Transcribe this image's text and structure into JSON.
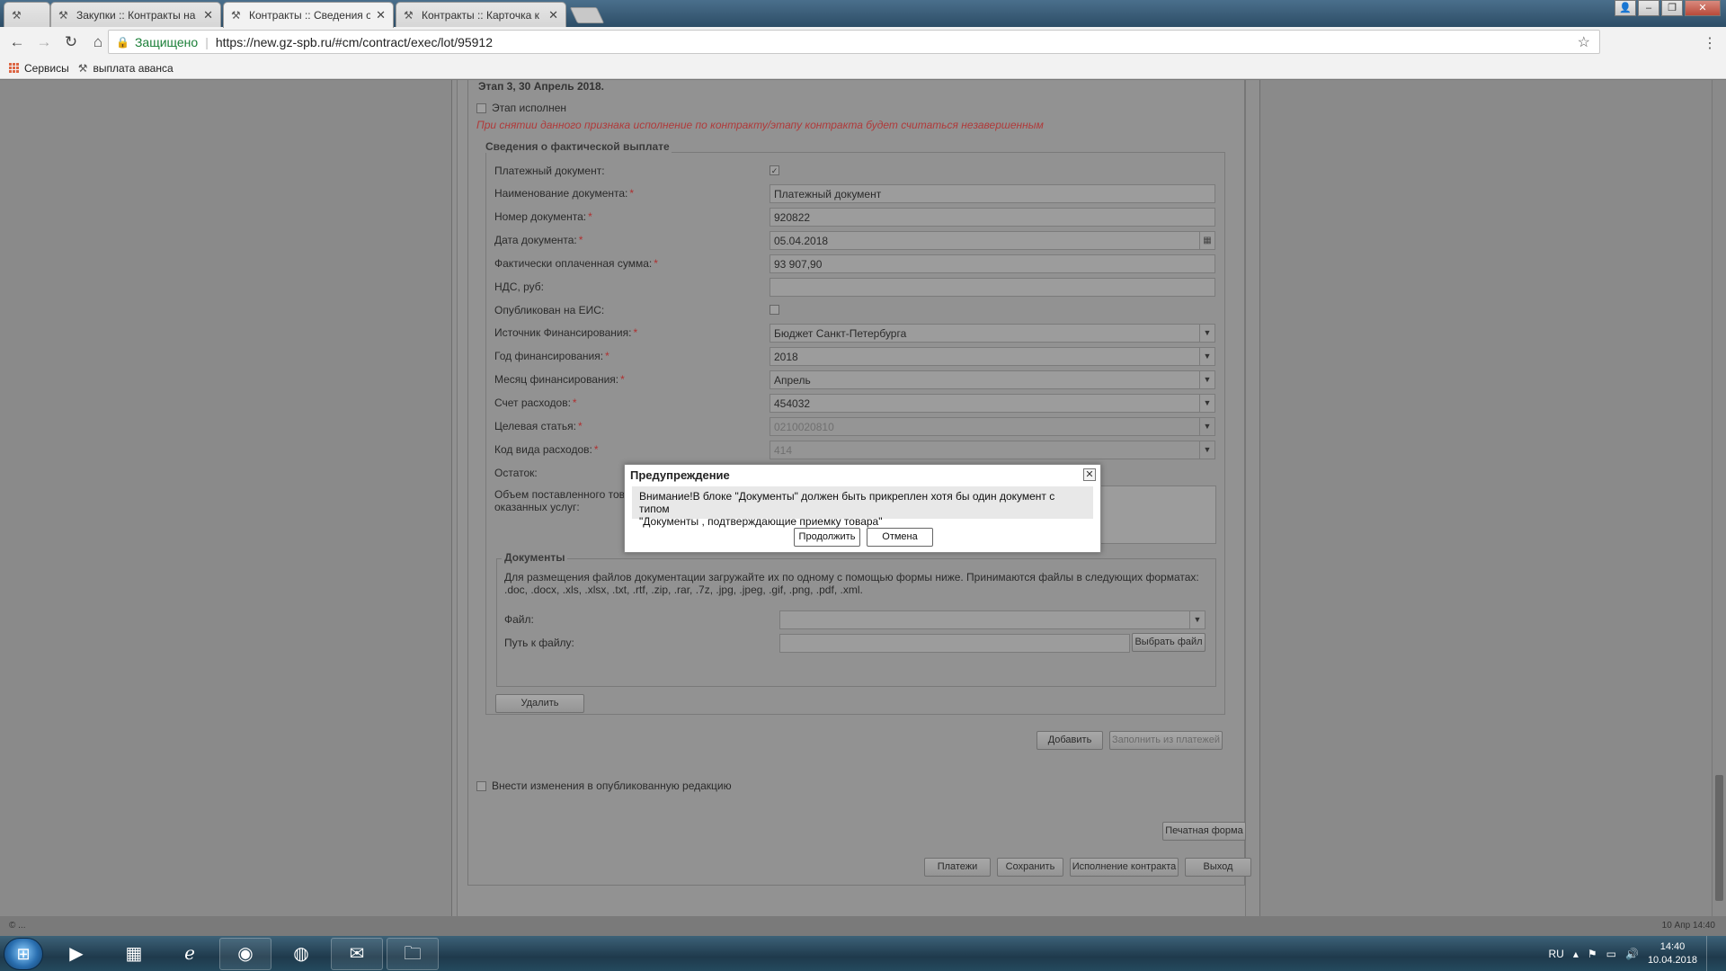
{
  "browser": {
    "tabs": [
      {
        "title": ""
      },
      {
        "title": "Закупки :: Контракты на"
      },
      {
        "title": "Контракты :: Сведения о"
      },
      {
        "title": "Контракты :: Карточка к"
      }
    ],
    "secure_label": "Защищено",
    "url": "https://new.gz-spb.ru/#cm/contract/exec/lot/95912",
    "bookmarks": [
      {
        "label": "Сервисы",
        "icon": "apps-grid-icon"
      },
      {
        "label": "выплата аванса",
        "icon": "site-favicon-icon"
      }
    ]
  },
  "stage": {
    "heading": "Этап 3, 30 Апрель 2018.",
    "completed_label": "Этап исполнен",
    "warning": "При снятии данного признака исполнение по контракту/этапу контракта будет считаться незавершенным"
  },
  "payment": {
    "legend": "Сведения о фактической выплате",
    "fields": [
      {
        "label": "Платежный документ:",
        "required": false,
        "type": "checkbox",
        "checked": true
      },
      {
        "label": "Наименование документа:",
        "required": true,
        "type": "text",
        "value": "Платежный документ"
      },
      {
        "label": "Номер документа:",
        "required": true,
        "type": "text",
        "value": "920822"
      },
      {
        "label": "Дата документа:",
        "required": true,
        "type": "date",
        "value": "05.04.2018"
      },
      {
        "label": "Фактически оплаченная сумма:",
        "required": true,
        "type": "text",
        "value": "93 907,90"
      },
      {
        "label": "НДС, руб:",
        "required": false,
        "type": "text",
        "value": ""
      },
      {
        "label": "Опубликован на ЕИС:",
        "required": false,
        "type": "checkbox",
        "checked": false
      },
      {
        "label": "Источник Финансирования:",
        "required": true,
        "type": "select",
        "value": "Бюджет Санкт-Петербурга"
      },
      {
        "label": "Год финансирования:",
        "required": true,
        "type": "select",
        "value": "2018"
      },
      {
        "label": "Месяц финансирования:",
        "required": true,
        "type": "select",
        "value": "Апрель"
      },
      {
        "label": "Счет расходов:",
        "required": true,
        "type": "select",
        "value": "454032"
      },
      {
        "label": "Целевая статья:",
        "required": true,
        "type": "select",
        "value": "0210020810",
        "disabled": true
      },
      {
        "label": "Код вида расходов:",
        "required": true,
        "type": "select",
        "value": "414",
        "disabled": true
      },
      {
        "label": "Остаток:",
        "required": false,
        "type": "none"
      }
    ],
    "volume_label_1": "Объем поставленного тов",
    "volume_label_2": "оказанных услуг:"
  },
  "documents": {
    "legend": "Документы",
    "hint": "Для размещения файлов документации загружайте их по одному с помощью формы ниже. Принимаются файлы в следующих форматах: .doc, .docx, .xls, .xlsx, .txt, .rtf, .zip, .rar, .7z, .jpg, .jpeg, .gif, .png, .pdf, .xml.",
    "file_label": "Файл:",
    "path_label": "Путь к файлу:",
    "choose_file": "Выбрать файл"
  },
  "buttons": {
    "delete": "Удалить",
    "add": "Добавить",
    "fill_from_payments": "Заполнить из платежей",
    "apply_changes": "Внести изменения в опубликованную редакцию",
    "print_form": "Печатная форма",
    "payments": "Платежи",
    "save": "Сохранить",
    "contract_execution": "Исполнение контракта",
    "exit": "Выход"
  },
  "modal": {
    "title": "Предупреждение",
    "message_line1": "Внимание!В блоке \"Документы\" должен быть прикреплен хотя бы один документ с типом",
    "message_line2": "\"Документы , подтверждающие приемку товара\"",
    "continue": "Продолжить",
    "cancel": "Отмена"
  },
  "statusbar": {
    "left": "© ...",
    "right": "10 Апр 14:40"
  },
  "taskbar": {
    "lang": "RU",
    "time": "14:40",
    "date": "10.04.2018"
  }
}
